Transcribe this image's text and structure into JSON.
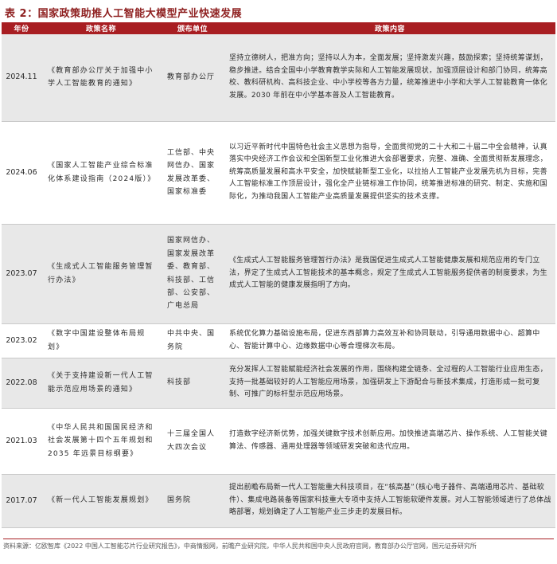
{
  "title": "表 2：国家政策助推人工智能大模型产业快速发展",
  "headers": {
    "year": "年份",
    "policy": "政策名称",
    "unit": "颁布单位",
    "content": "政策内容"
  },
  "rows": [
    {
      "year": "2024.11",
      "policy": "《教育部办公厅关于加强中小学人工智能教育的通知》",
      "unit": "教育部办公厅",
      "content": "坚持立德树人，把准方向；坚持以人为本，全面发展；坚持激发兴趣，鼓励探索；坚持统筹谋划，稳步推进。结合全国中小学教育教学实际和人工智能发展现状，加强顶层设计和部门协同，统筹高校、教科研机构、高科技企业、中小学校等各方力量，统筹推进中小学和大学人工智能教育一体化发展。2030 年前在中小学基本普及人工智能教育。"
    },
    {
      "year": "2024.06",
      "policy": "《国家人工智能产业综合标准化体系建设指南（2024版）》",
      "unit": "工信部、中央网信办、国家发展改革委、国家标准委",
      "content": "以习近平新时代中国特色社会主义思想为指导，全面贯彻党的二十大和二十届二中全会精神，认真落实中央经济工作会议和全国新型工业化推进大会部署要求，完整、准确、全面贯彻新发展理念，统筹高质量发展和高水平安全，加快赋能新型工业化，以拉抬人工智能产业发展先机为目标，完善人工智能标准工作顶层设计，强化全产业链标准工作协同，统筹推进标准的研究、制定、实施和国际化，为推动我国人工智能产业高质量发展提供坚实的技术支撑。"
    },
    {
      "year": "2023.07",
      "policy": "《生成式人工智能服务管理暂行办法》",
      "unit": "国家网信办、国家发展改革委、教育部、科技部、工信部、公安部、广电总局",
      "content": "《生成式人工智能服务管理暂行办法》是我国促进生成式人工智能健康发展和规范应用的专门立法，界定了生成式人工智能技术的基本概念，规定了生成式人工智能服务提供者的制度要求，为生成式人工智能的健康发展指明了方向。"
    },
    {
      "year": "2023.02",
      "policy": "《数字中国建设整体布局规划》",
      "unit": "中共中央、国务院",
      "content": "系统优化算力基础设施布局，促进东西部算力高效互补和协同联动，引导通用数据中心、超算中心、智能计算中心、边缘数据中心等合理梯次布局。"
    },
    {
      "year": "2022.08",
      "policy": "《关于支持建设新一代人工智能示范应用场景的通知》",
      "unit": "科技部",
      "content": "充分发挥人工智能赋能经济社会发展的作用，围绕构建全链条、全过程的人工智能行业应用生态，支持一批基础较好的人工智能应用场景，加强研发上下游配合与新技术集成，打造形成一批可复制、可推广的标杆型示范应用场景。"
    },
    {
      "year": "2021.03",
      "policy": "《中华人民共和国国民经济和社会发展第十四个五年规划和 2035 年远景目标纲要》",
      "unit": "十三届全国人大四次会议",
      "content": "打造数字经济新优势，加强关键数字技术创新应用。加快推进高端芯片、操作系统、人工智能关键算法、传感器、通用处理器等领域研发突破和迭代应用。"
    },
    {
      "year": "2017.07",
      "policy": "《新一代人工智能发展规划》",
      "unit": "国务院",
      "content": "提出前瞻布局新一代人工智能重大科技项目，在“核高基”（核心电子器件、高端通用芯片、基础软件）、集成电路装备等国家科技重大专项中支持人工智能软硬件发展。对人工智能领域进行了总体战略部署，规划确定了人工智能产业三步走的发展目标。"
    }
  ],
  "source": "资料来源：亿欧智库《2022 中国人工智能芯片行业研究报告》，中商情报网，前瞻产业研究院，中华人民共和国中央人民政府官网，教育部办公厅官网，国元证券研究所"
}
